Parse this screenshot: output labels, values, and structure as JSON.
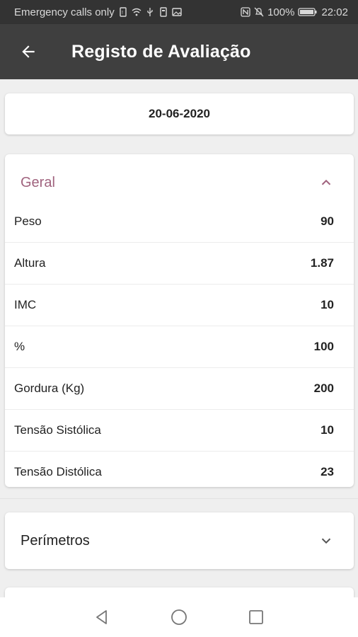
{
  "status_bar": {
    "carrier": "Emergency calls only",
    "battery": "100%",
    "time": "22:02"
  },
  "app_bar": {
    "title": "Registo de Avaliação",
    "back_icon": "arrow-back-icon"
  },
  "date": "20-06-2020",
  "geral": {
    "title": "Geral",
    "accent_color": "#a0637e",
    "rows": [
      {
        "label": "Peso",
        "value": "90"
      },
      {
        "label": "Altura",
        "value": "1.87"
      },
      {
        "label": "IMC",
        "value": "10"
      },
      {
        "label": "%",
        "value": "100"
      },
      {
        "label": "Gordura (Kg)",
        "value": "200"
      },
      {
        "label": "Tensão Sistólica",
        "value": "10"
      },
      {
        "label": "Tensão Distólica",
        "value": "23"
      }
    ]
  },
  "perimetros": {
    "title": "Perímetros"
  }
}
